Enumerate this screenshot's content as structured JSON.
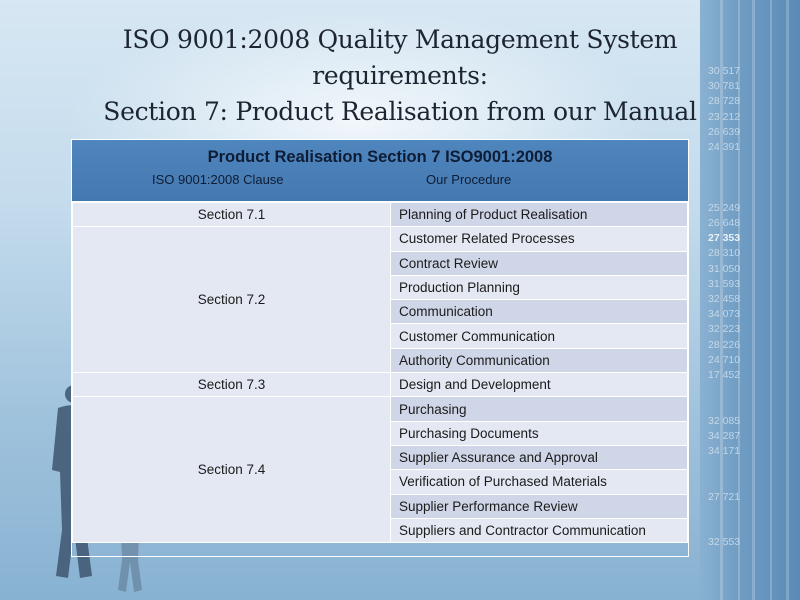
{
  "slide": {
    "title_lines": [
      "ISO 9001:2008 Quality Management System",
      "requirements:",
      "Section 7: Product Realisation from our Manual"
    ],
    "background_numbers": [
      "30 517",
      "30 781",
      "28 728",
      "23 212",
      "26 639",
      "24 391",
      "",
      "",
      "",
      "25 249",
      "26 648",
      "27 353",
      "28 310",
      "31 050",
      "31 593",
      "32 458",
      "34 073",
      "32 223",
      "28 226",
      "24 710",
      "17 452",
      "",
      "",
      "32 085",
      "34 287",
      "34 171",
      "",
      "",
      "27 721",
      "",
      "",
      "32 553"
    ],
    "background_highlight_index": 11
  },
  "table": {
    "title": "Product Realisation Section 7 ISO9001:2008",
    "col1_header": "ISO 9001:2008 Clause",
    "col2_header": "Our Procedure",
    "groups": [
      {
        "section": "Section 7.1",
        "procedures": [
          "Planning of Product Realisation"
        ]
      },
      {
        "section": "Section 7.2",
        "procedures": [
          "Customer Related Processes",
          "Contract Review",
          "Production Planning",
          "Communication",
          "Customer Communication",
          "Authority Communication"
        ]
      },
      {
        "section": "Section 7.3",
        "procedures": [
          "Design and Development"
        ]
      },
      {
        "section": "Section 7.4",
        "procedures": [
          "Purchasing",
          "Purchasing Documents",
          "Supplier Assurance and Approval",
          "Verification of Purchased Materials",
          "Supplier Performance Review",
          "Suppliers and Contractor Communication"
        ]
      }
    ]
  },
  "colors": {
    "header_blue": "#4a7fb6",
    "row_light": "#e3e8f2",
    "row_dark": "#cfd6e7",
    "title_text": "#1d2432"
  }
}
